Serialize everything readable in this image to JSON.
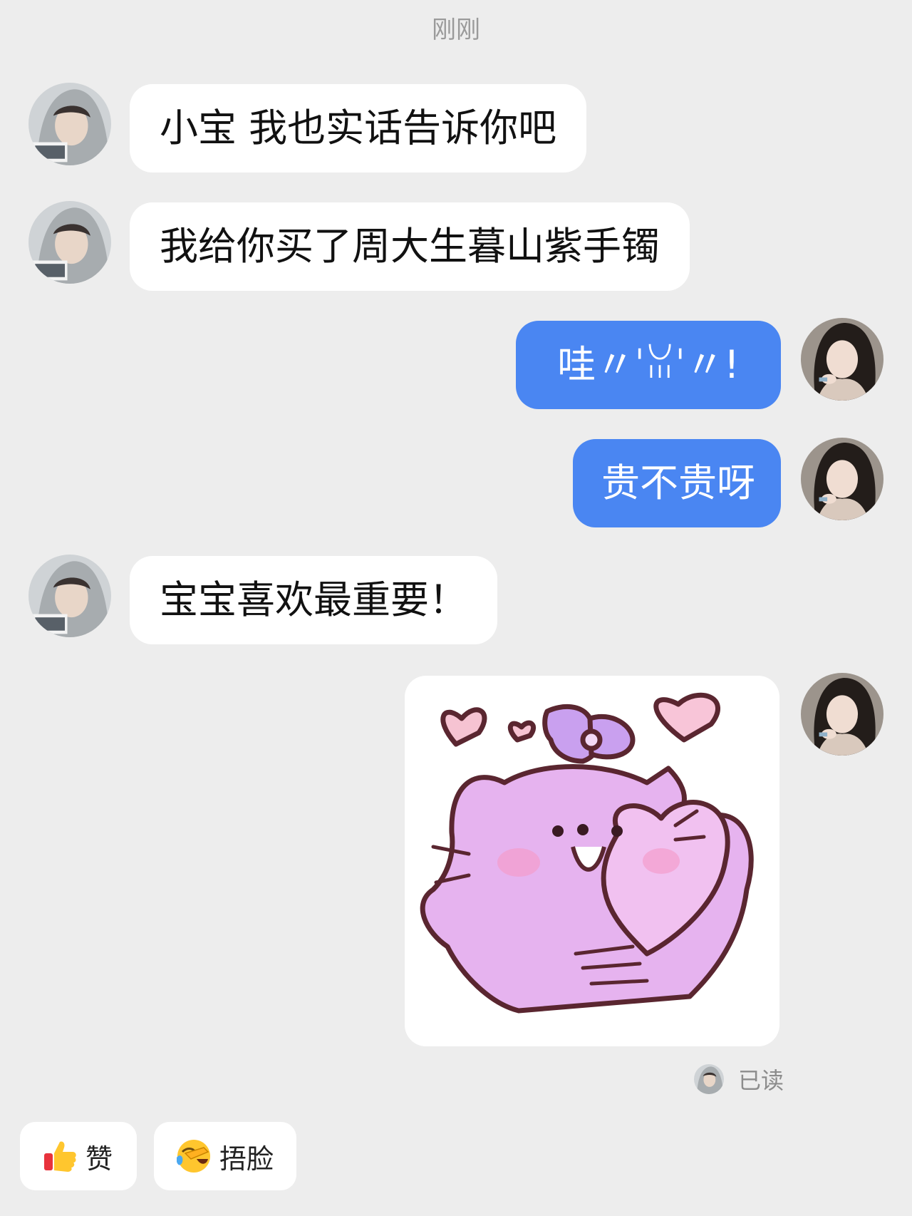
{
  "header": {
    "timestamp": "刚刚"
  },
  "messages": [
    {
      "side": "left",
      "text": "小宝 我也实话告诉你吧"
    },
    {
      "side": "left",
      "text": "我给你买了周大生暮山紫手镯"
    },
    {
      "side": "right",
      "text": "哇〃ˈꈍˈ〃!"
    },
    {
      "side": "right",
      "text": "贵不贵呀"
    },
    {
      "side": "left",
      "text": "宝宝喜欢最重要！"
    },
    {
      "side": "right",
      "sticker": "pink-cat-holding-heart-sticker"
    }
  ],
  "read_receipt": {
    "label": "已读"
  },
  "reactions": [
    {
      "icon": "thumbs-up-icon",
      "label": "赞"
    },
    {
      "icon": "facepalm-emoji-icon",
      "label": "捂脸"
    }
  ],
  "colors": {
    "background": "#ededed",
    "outgoing_bubble": "#4a86f2",
    "incoming_bubble": "#ffffff",
    "sticker_pink": "#e6b3ef"
  }
}
